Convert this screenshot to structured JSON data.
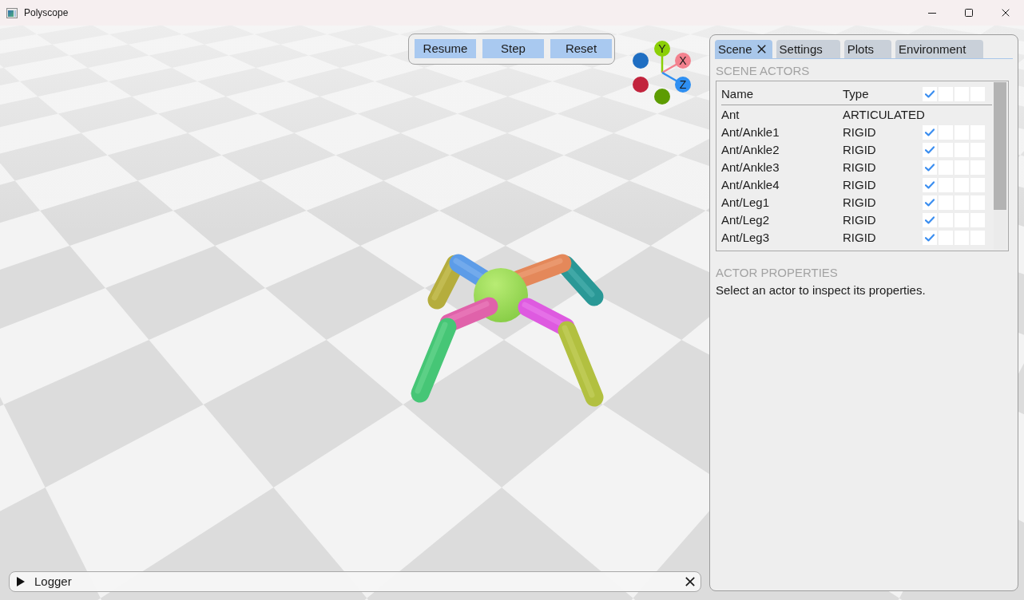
{
  "window": {
    "title": "Polyscope"
  },
  "toolbar": {
    "buttons": [
      "Resume",
      "Step",
      "Reset"
    ]
  },
  "axis_gizmo": {
    "axes": [
      {
        "label": "Y",
        "color": "#8bcf06"
      },
      {
        "label": "X",
        "color": "#f3818e"
      },
      {
        "label": "Z",
        "color": "#2e8ff2"
      }
    ],
    "opposite_dots": [
      {
        "color": "#5d9c02"
      },
      {
        "color": "#c2243d"
      },
      {
        "color": "#1f6ec2"
      }
    ]
  },
  "side_panel": {
    "tabs": [
      {
        "label": "Scene",
        "selected": true,
        "close_button": true
      },
      {
        "label": "Settings",
        "selected": false,
        "close_button": false
      },
      {
        "label": "Plots",
        "selected": false,
        "close_button": false
      },
      {
        "label": "Environment",
        "selected": false,
        "close_button": false
      }
    ],
    "scene_actors": {
      "heading": "SCENE ACTORS",
      "columns": [
        "Name",
        "Type"
      ],
      "header_checks": [
        true,
        false,
        false,
        false
      ],
      "rows": [
        {
          "name": "Ant",
          "type": "ARTICULATED"
        },
        {
          "name": "Ant/Ankle1",
          "type": "RIGID",
          "checks": [
            true,
            false,
            false,
            false
          ]
        },
        {
          "name": "Ant/Ankle2",
          "type": "RIGID",
          "checks": [
            true,
            false,
            false,
            false
          ]
        },
        {
          "name": "Ant/Ankle3",
          "type": "RIGID",
          "checks": [
            true,
            false,
            false,
            false
          ]
        },
        {
          "name": "Ant/Ankle4",
          "type": "RIGID",
          "checks": [
            true,
            false,
            false,
            false
          ]
        },
        {
          "name": "Ant/Leg1",
          "type": "RIGID",
          "checks": [
            true,
            false,
            false,
            false
          ]
        },
        {
          "name": "Ant/Leg2",
          "type": "RIGID",
          "checks": [
            true,
            false,
            false,
            false
          ]
        },
        {
          "name": "Ant/Leg3",
          "type": "RIGID",
          "checks": [
            true,
            false,
            false,
            false
          ]
        }
      ]
    },
    "actor_properties": {
      "heading": "ACTOR PROPERTIES",
      "message": "Select an actor to inspect its properties."
    }
  },
  "logger": {
    "label": "Logger",
    "expanded": false
  }
}
